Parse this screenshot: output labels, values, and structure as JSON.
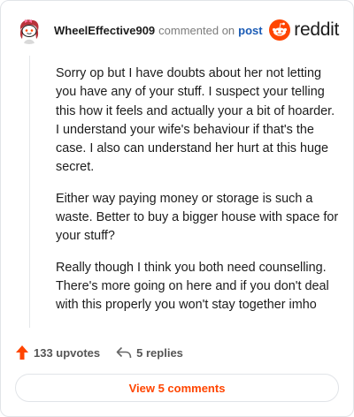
{
  "comment": {
    "author": "WheelEffective909",
    "action_text": "commented on",
    "post_link": "post",
    "brand_name": "reddit",
    "body": [
      "Sorry op but I have doubts about her not letting you have any of your stuff. I suspect your telling this how it feels and actually your a bit of hoarder. I understand your wife's behaviour if that's the case. I also can understand her hurt at this huge secret.",
      "Either way paying money or storage is such a waste. Better to buy a bigger house with space for your stuff?",
      "Really though I think you both need counselling. There's more going on here and if you don't deal with this properly you won't stay together imho"
    ],
    "upvotes_label": "133 upvotes",
    "replies_label": "5 replies",
    "view_comments_label": "View 5 comments"
  },
  "colors": {
    "brand_orange": "#ff4500",
    "link_blue": "#1a5bb5",
    "upvote_orange": "#ff4500"
  },
  "icons": {
    "avatar": "snoo-avatar",
    "brand": "reddit-logo-icon",
    "upvote": "upvote-arrow-icon",
    "reply": "reply-arrow-icon"
  }
}
